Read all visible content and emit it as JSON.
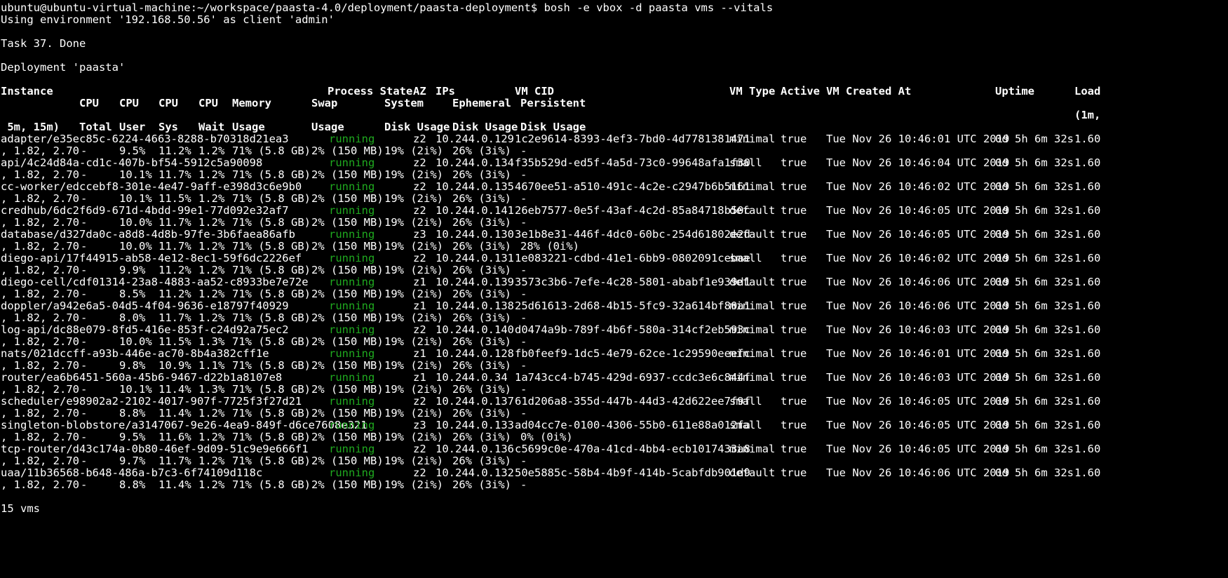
{
  "terminal": {
    "prompt": "ubuntu@ubuntu-virtual-machine:~/workspace/paasta-4.0/deployment/paasta-deployment$",
    "command": "bosh -e vbox -d paasta vms --vitals",
    "env_line": "Using environment '192.168.50.56' as client 'admin'",
    "task_line": "Task 37. Done",
    "deployment_line": "Deployment 'paasta'",
    "footer": "15 vms"
  },
  "table": {
    "headers": {
      "instance": "Instance",
      "process_state": "Process State",
      "az": "AZ",
      "ips": "IPs",
      "vm_cid": "VM CID",
      "vm_type": "VM Type",
      "active": "Active",
      "vm_created_at": "VM Created At",
      "uptime": "Uptime",
      "load": "Load",
      "cpu_total_1": "CPU",
      "cpu_user_1": "CPU",
      "cpu_sys_1": "CPU",
      "cpu_wait_1": "CPU",
      "memory_1": "Memory",
      "swap_1": "Swap",
      "system_1": "System",
      "ephemeral_1": "Ephemeral",
      "persistent_1": "Persistent",
      "load_cont": "(1m,",
      "load_tail": " 5m, 15m)",
      "cpu_total_2": "Total",
      "cpu_user_2": "User",
      "cpu_sys_2": "Sys",
      "cpu_wait_2": "Wait",
      "memory_2": "Usage",
      "swap_2": "Usage",
      "system_2": "Disk Usage",
      "ephemeral_2": "Disk Usage",
      "persistent_2": "Disk Usage"
    },
    "rows": [
      {
        "instance": "adapter/e35ec85c-6224-4663-8288-b70318d21ea3",
        "state": "running",
        "az": "z2",
        "ip": "10.244.0.129",
        "vm_cid": "1c2e9614-8393-4ef3-7bd0-4d7781381471",
        "vm_type": "minimal",
        "active": "true",
        "created": "Tue Nov 26 10:46:01 UTC 2019",
        "uptime": "0d 5h 6m 32s",
        "load": "1.60",
        "load_tail": ", 1.82, 2.70",
        "cpu_total": "-",
        "cpu_user": "9.5%",
        "cpu_sys": "11.2%",
        "cpu_wait": "1.2%",
        "memory": "71% (5.8 GB)",
        "swap": "2% (150 MB)",
        "system_disk": "19% (2i%)",
        "ephemeral_disk": "26% (3i%)",
        "persistent_disk": "-"
      },
      {
        "instance": "api/4c24d84a-cd1c-407b-bf54-5912c5a90098",
        "state": "running",
        "az": "z2",
        "ip": "10.244.0.134",
        "vm_cid": "f35b529d-ed5f-4a5d-73c0-99648afa1f30",
        "vm_type": "small",
        "active": "true",
        "created": "Tue Nov 26 10:46:04 UTC 2019",
        "uptime": "0d 5h 6m 32s",
        "load": "1.60",
        "load_tail": ", 1.82, 2.70",
        "cpu_total": "-",
        "cpu_user": "10.1%",
        "cpu_sys": "11.7%",
        "cpu_wait": "1.2%",
        "memory": "71% (5.8 GB)",
        "swap": "2% (150 MB)",
        "system_disk": "19% (2i%)",
        "ephemeral_disk": "26% (3i%)",
        "persistent_disk": "-"
      },
      {
        "instance": "cc-worker/edccebf8-301e-4e47-9aff-e398d3c6e9b0",
        "state": "running",
        "az": "z2",
        "ip": "10.244.0.135",
        "vm_cid": "4670ee51-a510-491c-4c2e-c2947b6b5161",
        "vm_type": "minimal",
        "active": "true",
        "created": "Tue Nov 26 10:46:02 UTC 2019",
        "uptime": "0d 5h 6m 32s",
        "load": "1.60",
        "load_tail": ", 1.82, 2.70",
        "cpu_total": "-",
        "cpu_user": "10.1%",
        "cpu_sys": "11.5%",
        "cpu_wait": "1.2%",
        "memory": "71% (5.8 GB)",
        "swap": "2% (150 MB)",
        "system_disk": "19% (2i%)",
        "ephemeral_disk": "26% (3i%)",
        "persistent_disk": "-"
      },
      {
        "instance": "credhub/6dc2f6d9-671d-4bdd-99e1-77d092e32af7",
        "state": "running",
        "az": "z2",
        "ip": "10.244.0.141",
        "vm_cid": "26eb7577-0e5f-43af-4c2d-85a84718b50c",
        "vm_type": "default",
        "active": "true",
        "created": "Tue Nov 26 10:46:05 UTC 2019",
        "uptime": "0d 5h 6m 32s",
        "load": "1.60",
        "load_tail": ", 1.82, 2.70",
        "cpu_total": "-",
        "cpu_user": "10.0%",
        "cpu_sys": "11.7%",
        "cpu_wait": "1.2%",
        "memory": "71% (5.8 GB)",
        "swap": "2% (150 MB)",
        "system_disk": "19% (2i%)",
        "ephemeral_disk": "26% (3i%)",
        "persistent_disk": "-"
      },
      {
        "instance": "database/d327da0c-a8d8-4d8b-97fe-3b6faea86afb",
        "state": "running",
        "az": "z3",
        "ip": "10.244.0.130",
        "vm_cid": "3e1b8e31-446f-4dc0-60bc-254d61802e2d",
        "vm_type": "default",
        "active": "true",
        "created": "Tue Nov 26 10:46:05 UTC 2019",
        "uptime": "0d 5h 6m 32s",
        "load": "1.60",
        "load_tail": ", 1.82, 2.70",
        "cpu_total": "-",
        "cpu_user": "10.0%",
        "cpu_sys": "11.7%",
        "cpu_wait": "1.2%",
        "memory": "71% (5.8 GB)",
        "swap": "2% (150 MB)",
        "system_disk": "19% (2i%)",
        "ephemeral_disk": "26% (3i%)",
        "persistent_disk": "28% (0i%)"
      },
      {
        "instance": "diego-api/17f44915-ab58-4e12-8ec1-59f6dc2226ef",
        "state": "running",
        "az": "z2",
        "ip": "10.244.0.131",
        "vm_cid": "1e083221-cdbd-41e1-6bb9-0802091cebae",
        "vm_type": "small",
        "active": "true",
        "created": "Tue Nov 26 10:46:02 UTC 2019",
        "uptime": "0d 5h 6m 32s",
        "load": "1.60",
        "load_tail": ", 1.82, 2.70",
        "cpu_total": "-",
        "cpu_user": "9.9%",
        "cpu_sys": "11.2%",
        "cpu_wait": "1.2%",
        "memory": "71% (5.8 GB)",
        "swap": "2% (150 MB)",
        "system_disk": "19% (2i%)",
        "ephemeral_disk": "26% (3i%)",
        "persistent_disk": "-"
      },
      {
        "instance": "diego-cell/cdf01314-23a8-4883-aa52-c8933be7e72e",
        "state": "running",
        "az": "z1",
        "ip": "10.244.0.139",
        "vm_cid": "3573c3b6-7efe-4c28-5801-ababf1e939d1",
        "vm_type": "default",
        "active": "true",
        "created": "Tue Nov 26 10:46:06 UTC 2019",
        "uptime": "0d 5h 6m 32s",
        "load": "1.60",
        "load_tail": ", 1.82, 2.70",
        "cpu_total": "-",
        "cpu_user": "8.5%",
        "cpu_sys": "11.2%",
        "cpu_wait": "1.2%",
        "memory": "71% (5.8 GB)",
        "swap": "2% (150 MB)",
        "system_disk": "19% (2i%)",
        "ephemeral_disk": "26% (3i%)",
        "persistent_disk": "-"
      },
      {
        "instance": "doppler/a942e6a5-04d5-4f04-9636-e18797f40929",
        "state": "running",
        "az": "z1",
        "ip": "10.244.0.138",
        "vm_cid": "25d61613-2d68-4b15-5fc9-32a614bf80a1",
        "vm_type": "minimal",
        "active": "true",
        "created": "Tue Nov 26 10:46:06 UTC 2019",
        "uptime": "0d 5h 6m 32s",
        "load": "1.60",
        "load_tail": ", 1.82, 2.70",
        "cpu_total": "-",
        "cpu_user": "8.0%",
        "cpu_sys": "11.7%",
        "cpu_wait": "1.2%",
        "memory": "71% (5.8 GB)",
        "swap": "2% (150 MB)",
        "system_disk": "19% (2i%)",
        "ephemeral_disk": "26% (3i%)",
        "persistent_disk": "-"
      },
      {
        "instance": "log-api/dc88e079-8fd5-416e-853f-c24d92a75ec2",
        "state": "running",
        "az": "z2",
        "ip": "10.244.0.140",
        "vm_cid": "d0474a9b-789f-4b6f-580a-314cf2eb593c",
        "vm_type": "minimal",
        "active": "true",
        "created": "Tue Nov 26 10:46:03 UTC 2019",
        "uptime": "0d 5h 6m 32s",
        "load": "1.60",
        "load_tail": ", 1.82, 2.70",
        "cpu_total": "-",
        "cpu_user": "10.0%",
        "cpu_sys": "11.5%",
        "cpu_wait": "1.3%",
        "memory": "71% (5.8 GB)",
        "swap": "2% (150 MB)",
        "system_disk": "19% (2i%)",
        "ephemeral_disk": "26% (3i%)",
        "persistent_disk": "-"
      },
      {
        "instance": "nats/021dccff-a93b-446e-ac70-8b4a382cff1e",
        "state": "running",
        "az": "z1",
        "ip": "10.244.0.128",
        "vm_cid": "fb0feef9-1dc5-4e79-62ce-1c29590eeefc",
        "vm_type": "minimal",
        "active": "true",
        "created": "Tue Nov 26 10:46:01 UTC 2019",
        "uptime": "0d 5h 6m 32s",
        "load": "1.60",
        "load_tail": ", 1.82, 2.70",
        "cpu_total": "-",
        "cpu_user": "9.8%",
        "cpu_sys": "10.9%",
        "cpu_wait": "1.1%",
        "memory": "71% (5.8 GB)",
        "swap": "2% (150 MB)",
        "system_disk": "19% (2i%)",
        "ephemeral_disk": "26% (3i%)",
        "persistent_disk": "-"
      },
      {
        "instance": "router/ea6b6451-560a-45b6-9467-d22b1a8107e8",
        "state": "running",
        "az": "z1",
        "ip": "10.244.0.34",
        "vm_cid": "1a743cc4-b745-429d-6937-ccdc3e6c844f",
        "vm_type": "minimal",
        "active": "true",
        "created": "Tue Nov 26 10:46:03 UTC 2019",
        "uptime": "0d 5h 6m 32s",
        "load": "1.60",
        "load_tail": ", 1.82, 2.70",
        "cpu_total": "-",
        "cpu_user": "10.1%",
        "cpu_sys": "11.4%",
        "cpu_wait": "1.3%",
        "memory": "71% (5.8 GB)",
        "swap": "2% (150 MB)",
        "system_disk": "19% (2i%)",
        "ephemeral_disk": "26% (3i%)",
        "persistent_disk": "-"
      },
      {
        "instance": "scheduler/e98902a2-2102-4017-907f-7725f3f27d21",
        "state": "running",
        "az": "z2",
        "ip": "10.244.0.137",
        "vm_cid": "61d206a8-355d-447b-44d3-42d622ee7f9f",
        "vm_type": "small",
        "active": "true",
        "created": "Tue Nov 26 10:46:05 UTC 2019",
        "uptime": "0d 5h 6m 32s",
        "load": "1.60",
        "load_tail": ", 1.82, 2.70",
        "cpu_total": "-",
        "cpu_user": "8.8%",
        "cpu_sys": "11.4%",
        "cpu_wait": "1.2%",
        "memory": "71% (5.8 GB)",
        "swap": "2% (150 MB)",
        "system_disk": "19% (2i%)",
        "ephemeral_disk": "26% (3i%)",
        "persistent_disk": "-"
      },
      {
        "instance": "singleton-blobstore/a3147067-9e26-4ea9-849f-d6ce7608e321",
        "state": "running",
        "az": "z3",
        "ip": "10.244.0.133",
        "vm_cid": "ad04cc7e-0100-4306-55b0-611e88a012fa",
        "vm_type": "small",
        "active": "true",
        "created": "Tue Nov 26 10:46:05 UTC 2019",
        "uptime": "0d 5h 6m 32s",
        "load": "1.60",
        "load_tail": ", 1.82, 2.70",
        "cpu_total": "-",
        "cpu_user": "9.5%",
        "cpu_sys": "11.6%",
        "cpu_wait": "1.2%",
        "memory": "71% (5.8 GB)",
        "swap": "2% (150 MB)",
        "system_disk": "19% (2i%)",
        "ephemeral_disk": "26% (3i%)",
        "persistent_disk": "0% (0i%)"
      },
      {
        "instance": "tcp-router/d43c174a-0b80-46ef-9d09-51c9e9e666f1",
        "state": "running",
        "az": "z2",
        "ip": "10.244.0.136",
        "vm_cid": "c5699c0e-470a-41cd-4bb4-ecb1017433a8",
        "vm_type": "minimal",
        "active": "true",
        "created": "Tue Nov 26 10:46:05 UTC 2019",
        "uptime": "0d 5h 6m 32s",
        "load": "1.60",
        "load_tail": ", 1.82, 2.70",
        "cpu_total": "-",
        "cpu_user": "9.7%",
        "cpu_sys": "11.7%",
        "cpu_wait": "1.2%",
        "memory": "71% (5.8 GB)",
        "swap": "2% (150 MB)",
        "system_disk": "19% (2i%)",
        "ephemeral_disk": "26% (3i%)",
        "persistent_disk": "-"
      },
      {
        "instance": "uaa/11b36568-b648-486a-b7c3-6f74109d118c",
        "state": "running",
        "az": "z2",
        "ip": "10.244.0.132",
        "vm_cid": "50e5885c-58b4-4b9f-414b-5cabfdb901d9",
        "vm_type": "default",
        "active": "true",
        "created": "Tue Nov 26 10:46:06 UTC 2019",
        "uptime": "0d 5h 6m 32s",
        "load": "1.60",
        "load_tail": ", 1.82, 2.70",
        "cpu_total": "-",
        "cpu_user": "8.8%",
        "cpu_sys": "11.4%",
        "cpu_wait": "1.2%",
        "memory": "71% (5.8 GB)",
        "swap": "2% (150 MB)",
        "system_disk": "19% (2i%)",
        "ephemeral_disk": "26% (3i%)",
        "persistent_disk": "-"
      }
    ]
  },
  "colors": {
    "background": "#000000",
    "text": "#ffffff",
    "running": "#1faa1f"
  }
}
